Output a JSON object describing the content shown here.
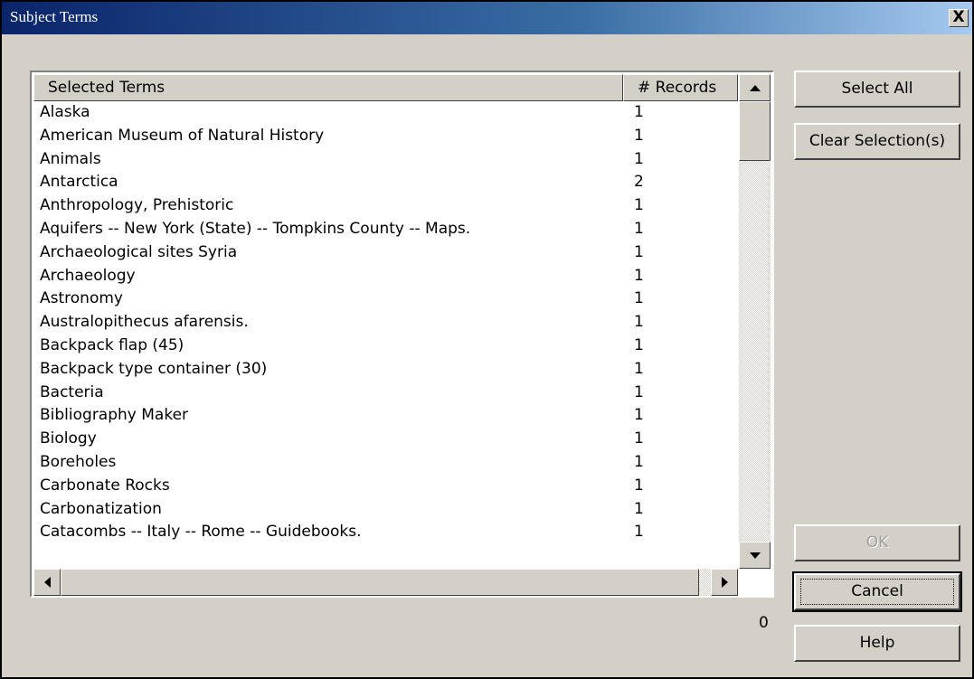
{
  "window": {
    "title": "Subject Terms",
    "close_label": "X"
  },
  "table": {
    "columns": [
      "Selected Terms",
      "# Records"
    ],
    "rows": [
      {
        "term": "Alaska",
        "records": "1"
      },
      {
        "term": "American Museum of Natural History",
        "records": "1"
      },
      {
        "term": "Animals",
        "records": "1"
      },
      {
        "term": "Antarctica",
        "records": "2"
      },
      {
        "term": "Anthropology, Prehistoric",
        "records": "1"
      },
      {
        "term": "Aquifers -- New York (State) -- Tompkins County -- Maps.",
        "records": "1"
      },
      {
        "term": "Archaeological sites Syria",
        "records": "1"
      },
      {
        "term": "Archaeology",
        "records": "1"
      },
      {
        "term": "Astronomy",
        "records": "1"
      },
      {
        "term": "Australopithecus afarensis.",
        "records": "1"
      },
      {
        "term": "Backpack flap (45)",
        "records": "1"
      },
      {
        "term": "Backpack type container (30)",
        "records": "1"
      },
      {
        "term": "Bacteria",
        "records": "1"
      },
      {
        "term": "Bibliography Maker",
        "records": "1"
      },
      {
        "term": "Biology",
        "records": "1"
      },
      {
        "term": "Boreholes",
        "records": "1"
      },
      {
        "term": "Carbonate Rocks",
        "records": "1"
      },
      {
        "term": "Carbonatization",
        "records": "1"
      },
      {
        "term": "Catacombs -- Italy -- Rome -- Guidebooks.",
        "records": "1"
      }
    ]
  },
  "selection_count": "0",
  "buttons": {
    "select_all": "Select All",
    "clear_selection": "Clear Selection(s)",
    "ok": "OK",
    "cancel": "Cancel",
    "help": "Help"
  },
  "icons": {
    "close": "close-icon",
    "scroll_up": "arrow-up-icon",
    "scroll_down": "arrow-down-icon",
    "scroll_left": "arrow-left-icon",
    "scroll_right": "arrow-right-icon"
  },
  "colors": {
    "titlebar_start": "#0a246a",
    "titlebar_end": "#a6caf0",
    "dialog_face": "#d4d0c8"
  }
}
